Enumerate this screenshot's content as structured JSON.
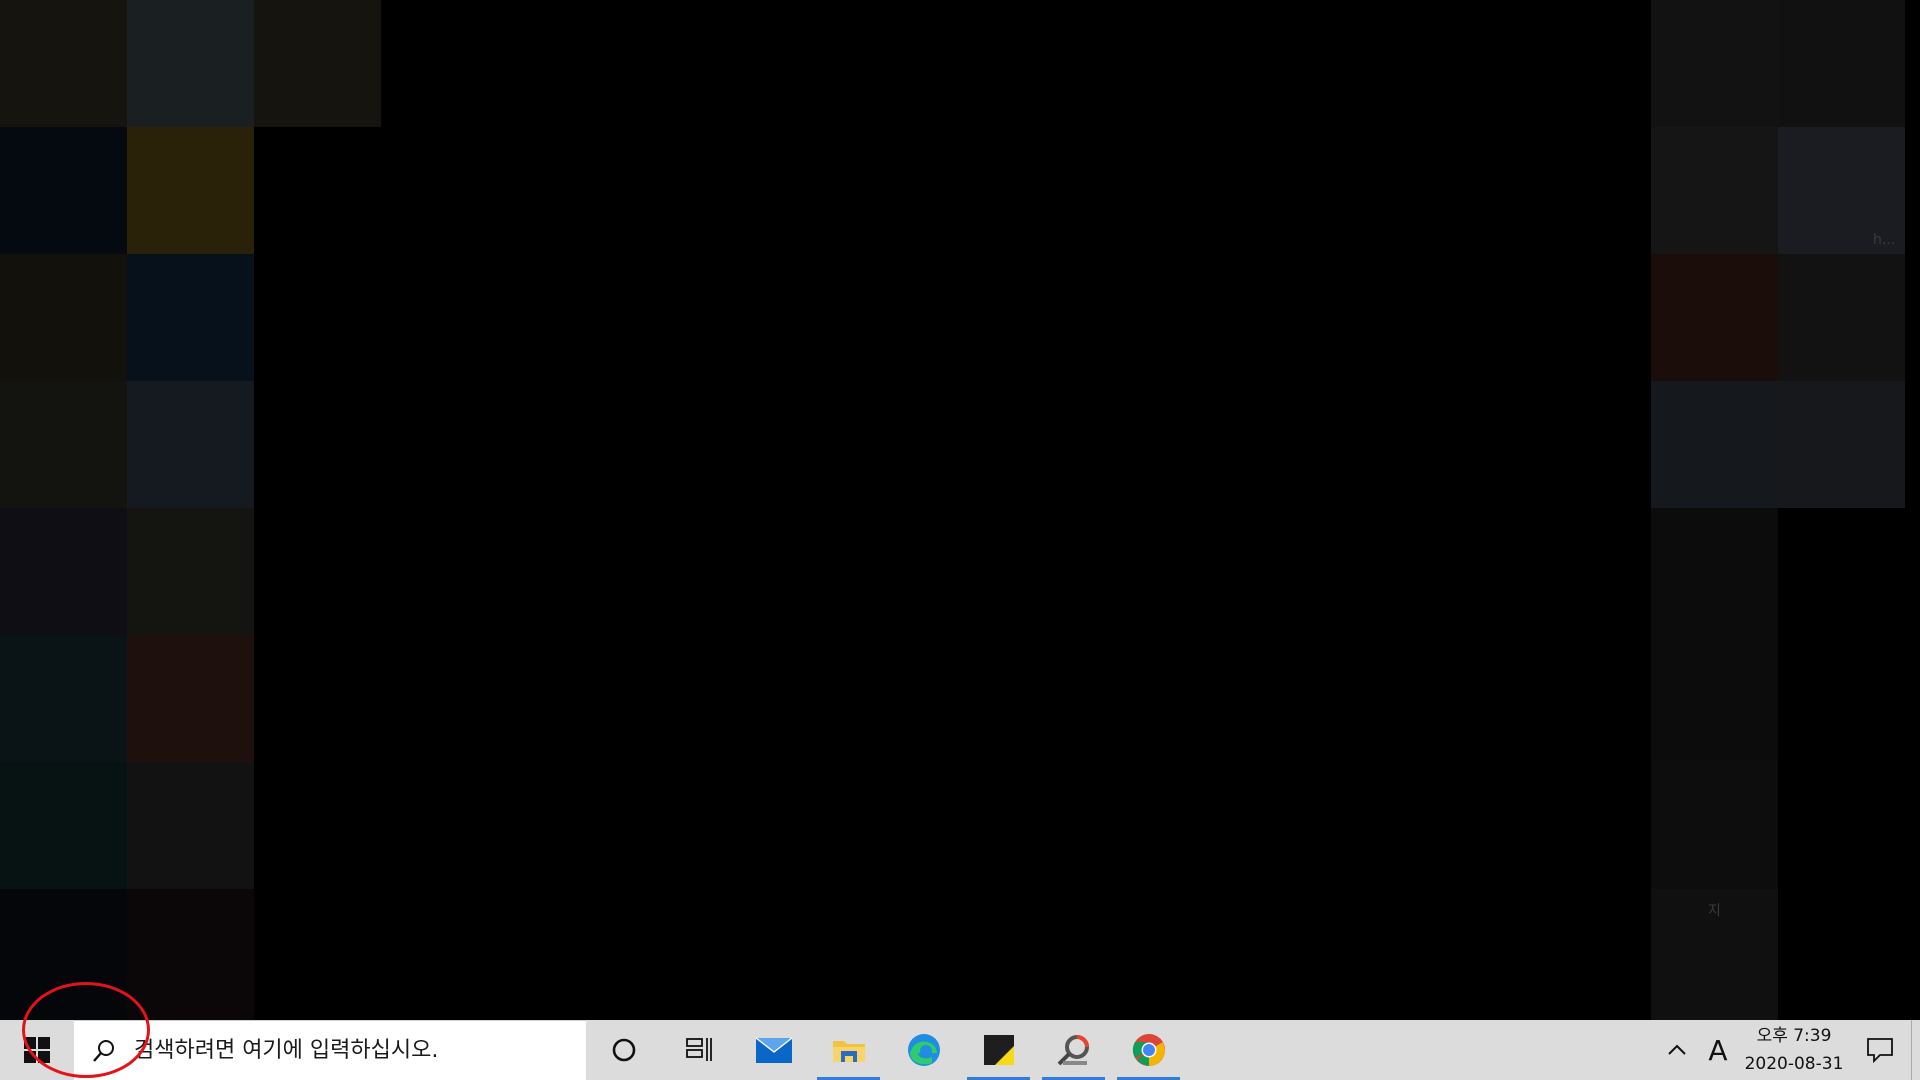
{
  "desktop": {
    "left_tiles": [
      {
        "color": "#16140f"
      },
      {
        "color": "#1a1f22"
      },
      {
        "color": "#15140f"
      },
      {
        "color": "#050910"
      },
      {
        "color": "#2a2208"
      },
      {
        "color": "#12110c"
      },
      {
        "color": "#07111c"
      },
      {
        "color": "#131310"
      },
      {
        "color": "#141a20"
      },
      {
        "color": "#0f0e15"
      },
      {
        "color": "#141510"
      },
      {
        "color": "#0a1316"
      },
      {
        "color": "#1e100c"
      },
      {
        "color": "#071212"
      },
      {
        "color": "#121212"
      },
      {
        "color": "#05060a"
      },
      {
        "color": "#0b0709"
      }
    ],
    "right_tiles": [
      {
        "color": "#121212"
      },
      {
        "color": "#111111"
      },
      {
        "color": "#151515"
      },
      {
        "color": "#1a1c22"
      },
      {
        "color": "#1a0d0a"
      },
      {
        "color": "#121212"
      },
      {
        "color": "#15181c"
      },
      {
        "color": "#16181b"
      },
      {
        "color": "#0c0c0c"
      },
      {
        "color": "#0d0d0d"
      },
      {
        "color": "#101010"
      }
    ],
    "tile_labels": {
      "right_ellipsis": "h...",
      "bottom_char": "지"
    }
  },
  "taskbar": {
    "search": {
      "placeholder": "검색하려면 여기에 입력하십시오."
    },
    "pinned": [
      {
        "name": "cortana",
        "icon": "circle-icon",
        "running": false
      },
      {
        "name": "task-view",
        "icon": "task-view-icon",
        "running": false
      },
      {
        "name": "mail",
        "icon": "mail-icon",
        "running": false
      },
      {
        "name": "file-explorer",
        "icon": "folder-icon",
        "running": true
      },
      {
        "name": "edge",
        "icon": "edge-icon",
        "running": false
      },
      {
        "name": "sticky-notes",
        "icon": "sticky-notes-icon",
        "running": true
      },
      {
        "name": "picpick",
        "icon": "picpick-icon",
        "running": true
      },
      {
        "name": "chrome",
        "icon": "chrome-icon",
        "running": true
      }
    ],
    "tray": {
      "ime": "A",
      "time": "오후 7:39",
      "date": "2020-08-31"
    },
    "colors": {
      "background": "#dcdcdc",
      "running_indicator": "#2e7fd6",
      "annotation": "#e0141a"
    }
  }
}
